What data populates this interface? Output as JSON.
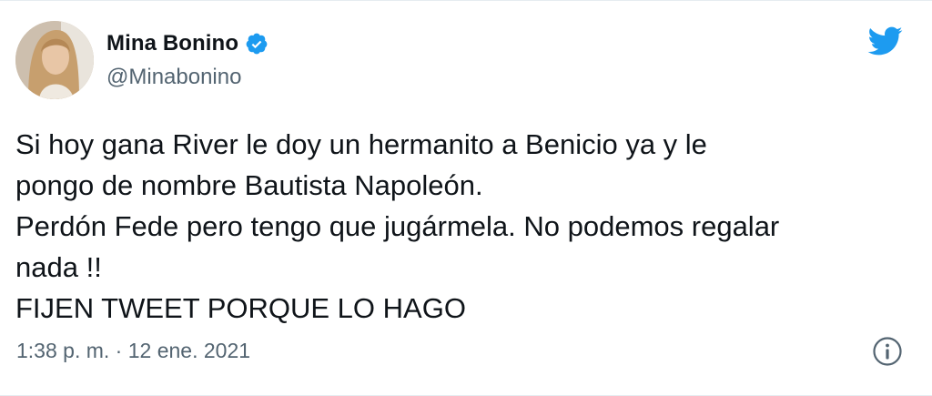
{
  "author": {
    "display_name": "Mina Bonino",
    "handle": "@Minabonino",
    "avatar_icon": "profile-photo"
  },
  "tweet": {
    "text": "Si hoy gana River le doy un hermanito a Benicio ya y le\npongo de nombre Bautista Napoleón.\nPerdón Fede pero tengo que jugármela. No podemos regalar\nnada !!\nFIJEN TWEET PORQUE LO HAGO",
    "time": "1:38 p. m.",
    "separator": " · ",
    "date": "12 ene. 2021"
  },
  "icons": {
    "verified": "verified-badge-icon",
    "brand": "twitter-bird-icon",
    "info": "info-icon"
  },
  "colors": {
    "brand": "#1d9bf0",
    "text": "#0f1419",
    "secondary": "#536471"
  }
}
